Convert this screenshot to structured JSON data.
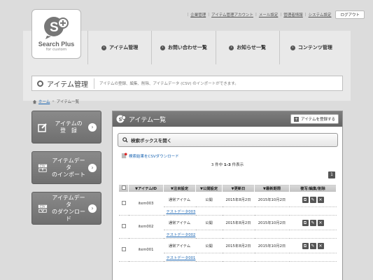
{
  "logo": {
    "brand": "Search Plus",
    "sub": "for custom"
  },
  "toplinks": [
    "企業管理",
    "アイテム管理アカウント",
    "メール設定",
    "管理者情報",
    "システム設定"
  ],
  "logout": "ログアウト",
  "nav": [
    "アイテム管理",
    "お問い合わせ一覧",
    "お知らせ一覧",
    "コンテンツ管理"
  ],
  "page": {
    "title": "アイテム管理",
    "desc": "アイテムの登録、編集、削除、アイテムデータ (CSV) のインポートができます。"
  },
  "breadcrumb": {
    "home": "ホーム",
    "arrow": "»",
    "current": "アイテム一覧"
  },
  "side": [
    {
      "label": "アイテムの\n登　録",
      "icon": "edit-icon"
    },
    {
      "label": "アイテムデータ\nのインポート",
      "icon": "csv-import-icon"
    },
    {
      "label": "アイテムデータ\nのダウンロード",
      "icon": "csv-download-icon"
    }
  ],
  "panel": {
    "title": "アイテム一覧",
    "register": "アイテムを登録する",
    "search": "検索ボックスを開く",
    "csv": "検索結果をCSVダウンロード",
    "count_pre": "3 件中 ",
    "count_range": "1-3",
    "count_post": " 件表示",
    "page": "1"
  },
  "table": {
    "headers": [
      "",
      "▼アイテムID",
      "▼注目設定",
      "▼公開設定",
      "▼更新日",
      "▼最新期限",
      "複写/編集/削除"
    ],
    "rows": [
      {
        "id": "item003",
        "attn": "通常アイテム",
        "pub": "公開",
        "upd": "2015年8月2日",
        "exp": "2015年10月2日",
        "name": "テストデータ003"
      },
      {
        "id": "item002",
        "attn": "通常アイテム",
        "pub": "公開",
        "upd": "2015年8月2日",
        "exp": "2015年10月2日",
        "name": "テストデータ002"
      },
      {
        "id": "item001",
        "attn": "通常アイテム",
        "pub": "公開",
        "upd": "2015年8月2日",
        "exp": "2015年10月2日",
        "name": "テストデータ001"
      }
    ]
  },
  "colors": {
    "bg": "#dcdcdc",
    "panel_head": "#6f6f6f",
    "link": "#1b66b3"
  }
}
